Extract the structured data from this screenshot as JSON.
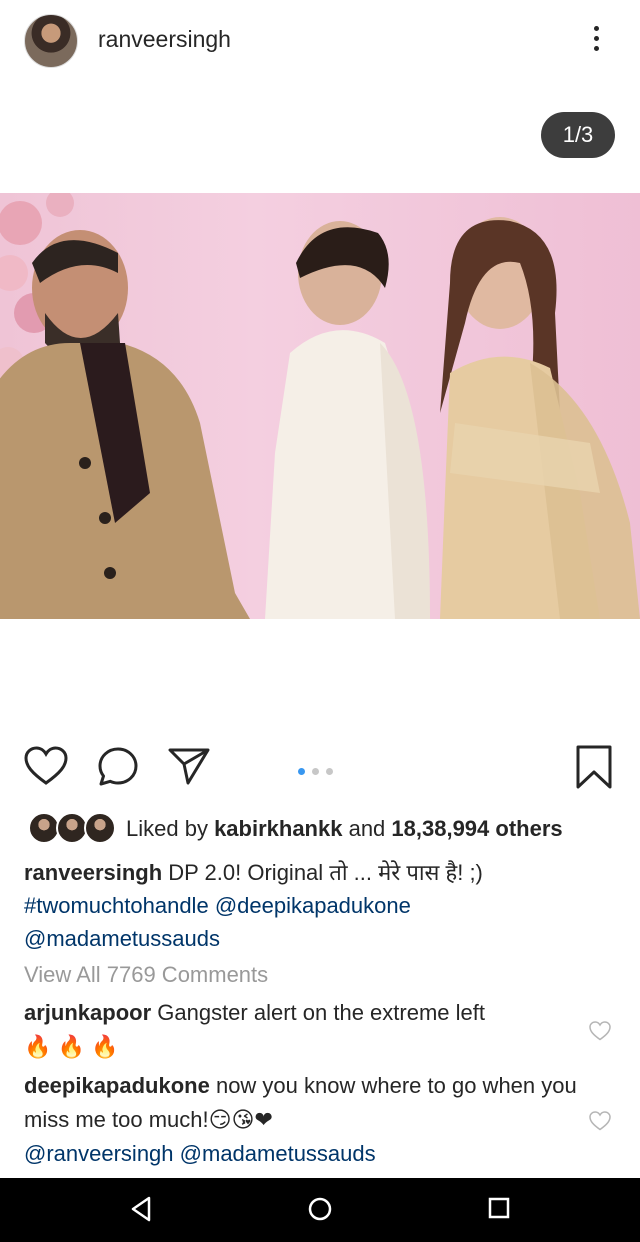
{
  "post": {
    "username": "ranveersingh",
    "counter": "1/3"
  },
  "likes": {
    "prefix": "Liked by ",
    "user": "kabirkhankk",
    "and": " and ",
    "count": "18,38,994 others"
  },
  "caption": {
    "username": "ranveersingh",
    "text": " DP 2.0! Original तो ... मेरे पास है! ;)",
    "hashtag": "#twomuchtohandle",
    "mention1": "@deepikapadukone",
    "mention2": "@madametussauds"
  },
  "view_all": "View All 7769 Comments",
  "comments": [
    {
      "user": "arjunkapoor",
      "text": " Gangster alert on the extreme left",
      "line2": "🔥 🔥 🔥"
    },
    {
      "user": "deepikapadukone",
      "text": " now you know where to go when you miss me too much!😏😘❤",
      "mention1": "@ranveersingh",
      "mention2": "@madametussauds"
    }
  ],
  "carousel": {
    "total": 3,
    "active": 1
  },
  "icons": {
    "like": "heart-icon",
    "comment": "comment-icon",
    "share": "send-icon",
    "save": "bookmark-icon",
    "more": "more-vertical-icon"
  },
  "colors": {
    "link": "#003569",
    "active_dot": "#3897f0",
    "muted": "#999999"
  }
}
